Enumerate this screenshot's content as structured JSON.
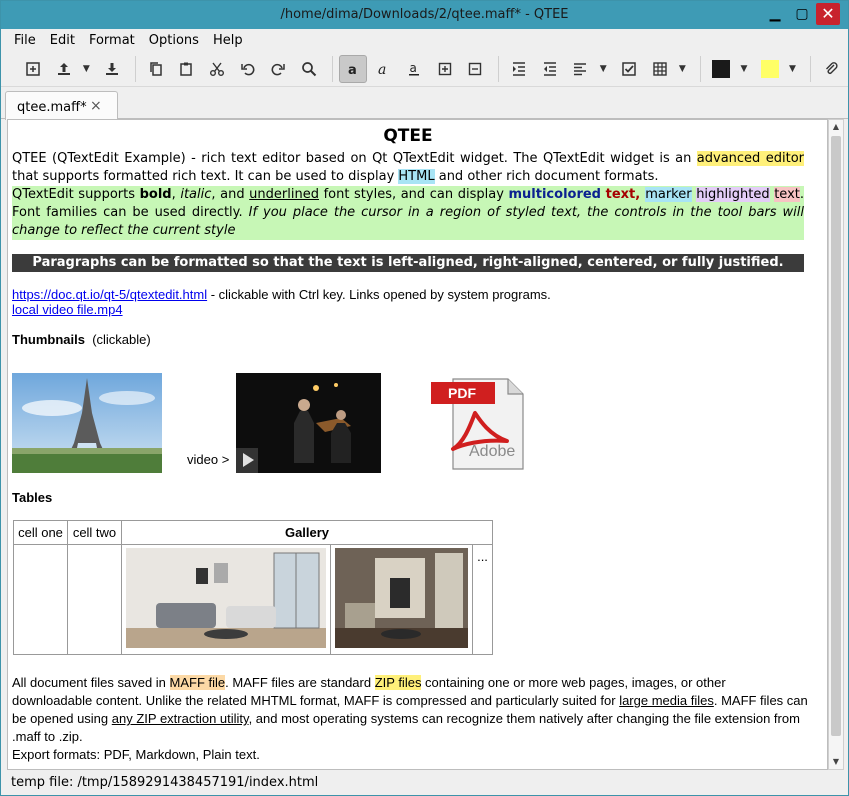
{
  "window": {
    "title": "/home/dima/Downloads/2/qtee.maff* - QTEE",
    "min": "▁",
    "max": "▢",
    "close": "✕"
  },
  "menu": [
    "File",
    "Edit",
    "Format",
    "Options",
    "Help"
  ],
  "toolbar": {
    "text_color": "#1a1a1a",
    "highlight_color": "#ffff66"
  },
  "tab": {
    "label": "qtee.maff*",
    "close": "×"
  },
  "doc": {
    "title": "QTEE",
    "p1_a": "QTEE (QTextEdit Example) - rich text editor based on Qt QTextEdit widget. The QTextEdit widget is an ",
    "p1_hl": "advanced editor",
    "p1_b": " that supports formatted rich text. It can be used to display ",
    "p1_html": "HTML",
    "p1_c": " and other rich document formats.",
    "p2_a": "QTextEdit supports ",
    "p2_bold": "bold",
    "p2_comma1": ", ",
    "p2_italic": "italic",
    "p2_and": ", and ",
    "p2_underlined": "underlined",
    "p2_b": " font styles, and can display ",
    "p2_multi": "multicolored",
    "p2_text": "text",
    "p2_comma2": ", ",
    "p2_marker": "marker",
    "p2_highlighted": "highlighted",
    "p2_text2": "text",
    "p2_c": ". Font families can be used directly. ",
    "p2_italic_tail": "If you place the cursor in a region of styled text, the controls in the tool bars will change to reflect the current style",
    "banner": "Paragraphs can be formatted so that the text is left-aligned, right-aligned, centered, or fully justified.",
    "link1": "https://doc.qt.io/qt-5/qtextedit.html",
    "link1_note": "  - clickable with Ctrl key.  Links opened by system programs.",
    "link2": "local video file.mp4",
    "thumbs_heading": "Thumbnails",
    "thumbs_note": "(clickable)",
    "video_label": "video >",
    "pdf_label": "PDF",
    "adobe_label": "Adobe",
    "tables_heading": "Tables",
    "table": {
      "c1": "cell one",
      "c2": "cell two",
      "gallery": "Gallery",
      "ellipsis": "..."
    },
    "f1_a": "All document files saved in ",
    "f1_maff": "MAFF file",
    "f1_b": ".  MAFF files are standard ",
    "f1_zip": "ZIP files",
    "f1_c": " containing one or more web pages, images, or other downloadable content. Unlike the related MHTML format, MAFF is compressed and particularly suited for ",
    "f1_large": "large media files",
    "f1_d": ". MAFF files can be opened using ",
    "f1_any": "any ZIP extraction utility",
    "f1_e": ", and most operating systems can recognize them natively after changing the file extension from .maff to .zip.",
    "export": "Export formats: PDF, Markdown, Plain text."
  },
  "status": "temp file: /tmp/1589291438457191/index.html"
}
